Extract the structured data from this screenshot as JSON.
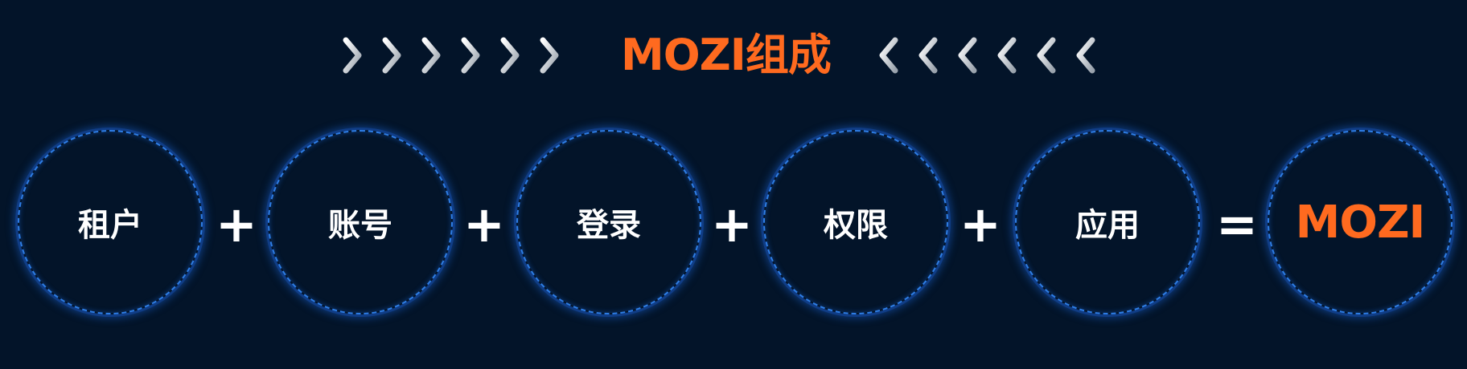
{
  "header": {
    "title": "MOZI组成",
    "chevron_left_group": "chevron-right-icon",
    "chevron_right_group": "chevron-left-icon"
  },
  "formula": {
    "terms": [
      "租户",
      "账号",
      "登录",
      "权限",
      "应用"
    ],
    "plus_operator": "+",
    "equals_operator": "=",
    "result": "MOZI"
  },
  "colors": {
    "background": "#031429",
    "accent": "#ff6a1f",
    "circle_border": "#2e7ee6",
    "text": "#ffffff",
    "chevron": "#c8ced6"
  }
}
